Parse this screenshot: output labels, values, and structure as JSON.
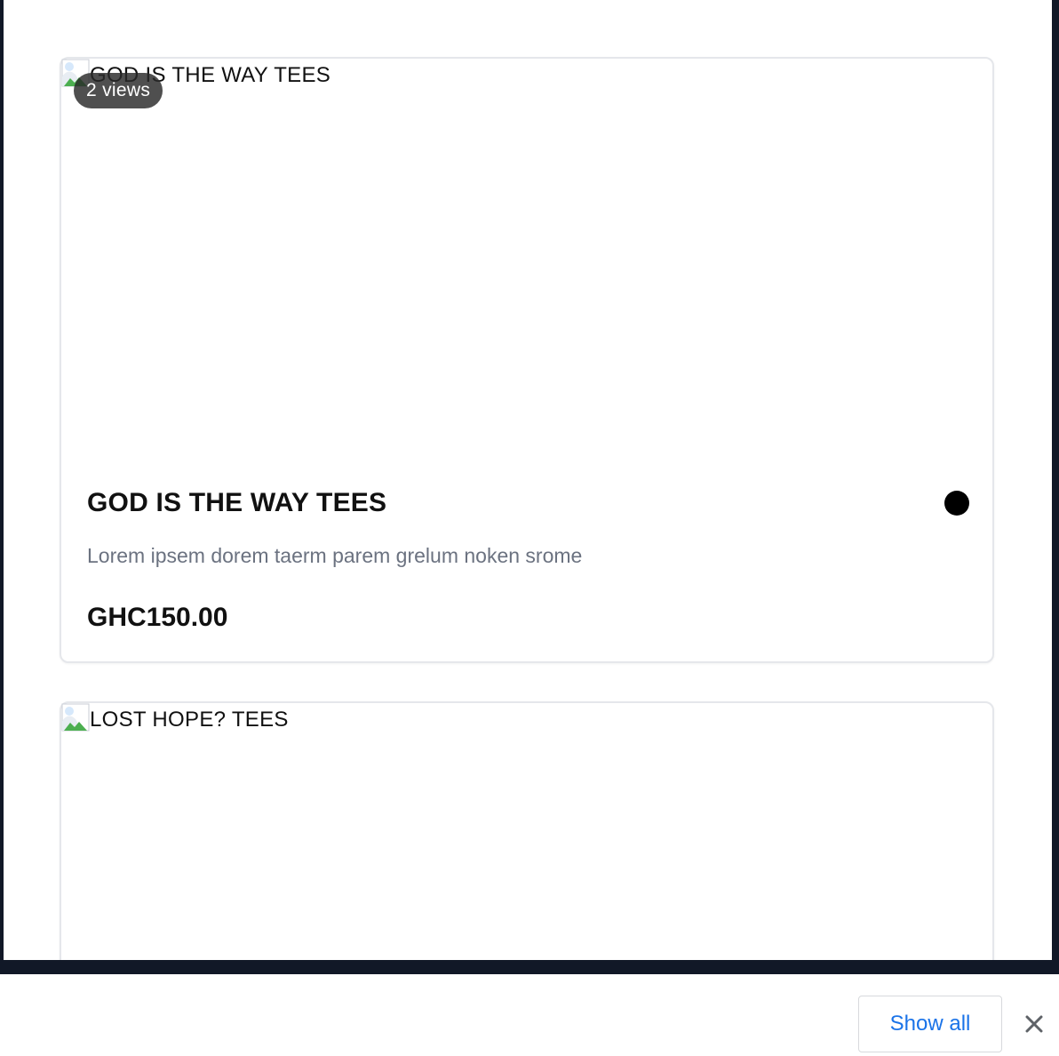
{
  "products": [
    {
      "image_alt": "GOD IS THE WAY TEES",
      "views_badge": "2 views",
      "title": "GOD IS THE WAY TEES",
      "description": "Lorem ipsem dorem taerm parem grelum noken srome",
      "price": "GHC150.00",
      "status_dot_color": "#000000"
    },
    {
      "image_alt": "LOST HOPE? TEES"
    }
  ],
  "download_bar": {
    "show_all_label": "Show all",
    "close_icon": "close-icon"
  },
  "colors": {
    "frame": "#111827",
    "link_blue": "#1a73e8",
    "muted_text": "#6b7280"
  }
}
